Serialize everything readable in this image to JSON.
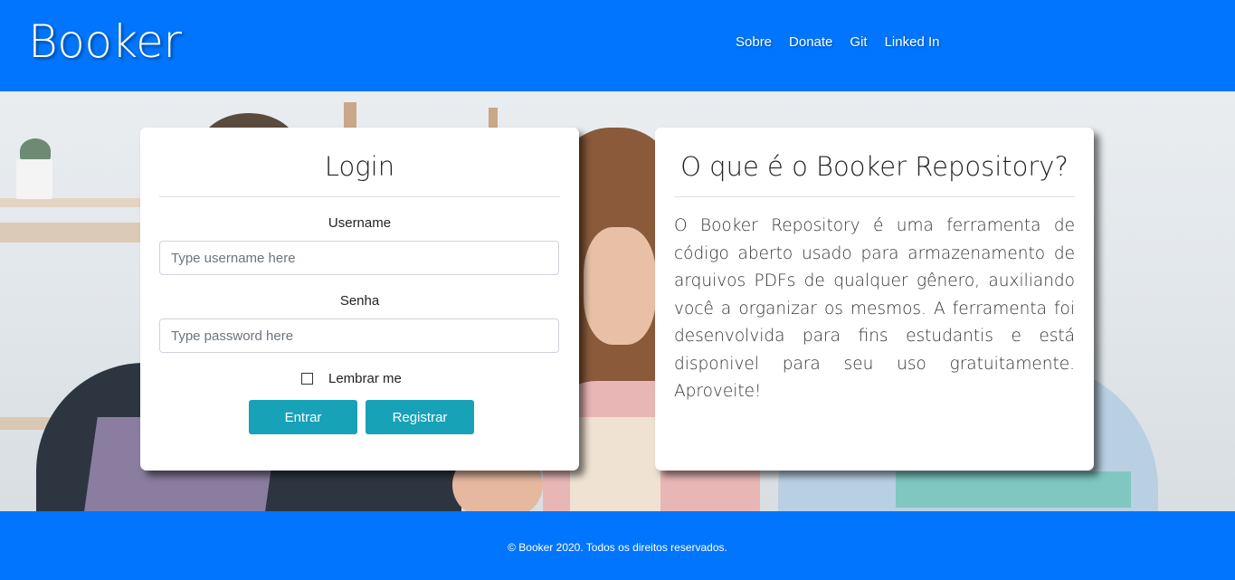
{
  "header": {
    "brand": "Booker",
    "nav": [
      {
        "label": "Sobre"
      },
      {
        "label": "Donate"
      },
      {
        "label": "Git"
      },
      {
        "label": "Linked In"
      }
    ]
  },
  "login": {
    "title": "Login",
    "username_label": "Username",
    "username_placeholder": "Type username here",
    "password_label": "Senha",
    "password_placeholder": "Type password here",
    "remember_label": "Lembrar me",
    "remember_checked": false,
    "enter_button": "Entrar",
    "register_button": "Registrar"
  },
  "about": {
    "title": "O que é o Booker Repository?",
    "text": "O Booker Repository é uma ferramenta de código aberto usado para armazenamento de arquivos PDFs de qualquer gênero, auxiliando você a organizar os mesmos. A ferramenta foi desenvolvida para fins estudantis e está disponivel para seu uso gratuitamente. Aproveite!"
  },
  "footer": {
    "text": "© Booker 2020. Todos os direitos reservados."
  },
  "colors": {
    "primary": "#0175fd",
    "button": "#17a2b8"
  }
}
